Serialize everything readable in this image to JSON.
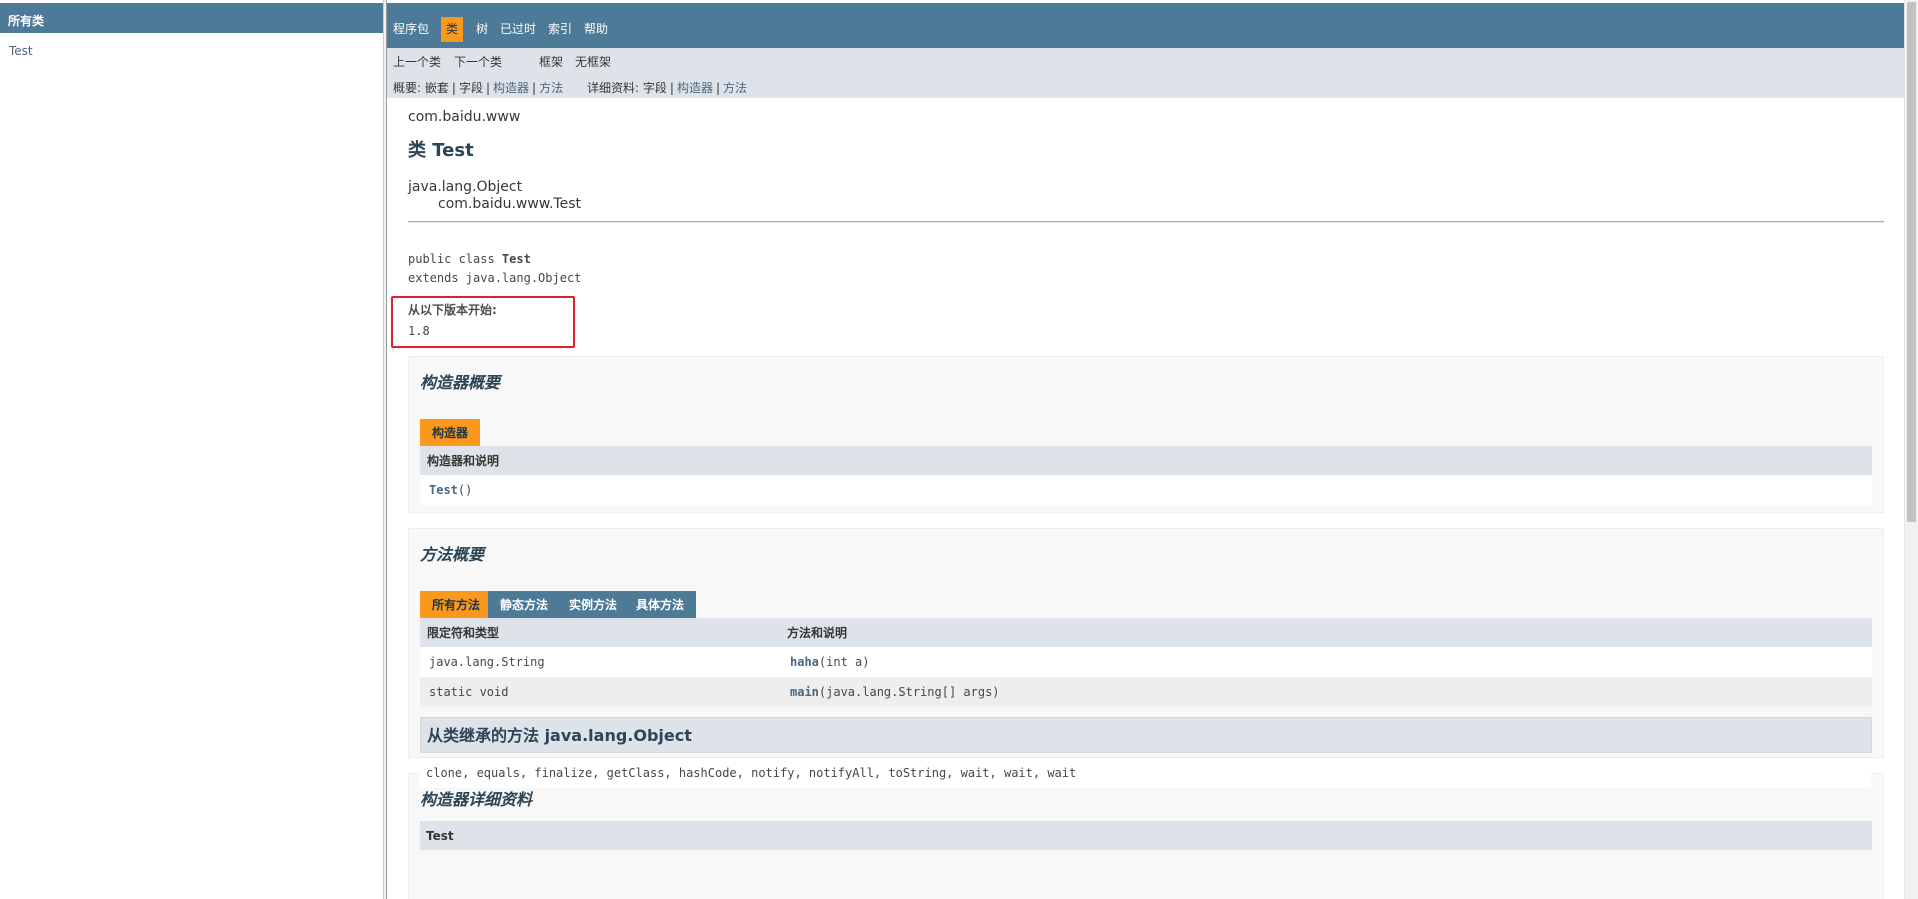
{
  "left_frame": {
    "header": "所有类",
    "classes": [
      "Test"
    ]
  },
  "top_nav": {
    "items": [
      {
        "label": "程序包",
        "active": false
      },
      {
        "label": "类",
        "active": true
      },
      {
        "label": "树",
        "active": false
      },
      {
        "label": "已过时",
        "active": false
      },
      {
        "label": "索引",
        "active": false
      },
      {
        "label": "帮助",
        "active": false
      }
    ]
  },
  "sub_nav": {
    "prev_class": "上一个类",
    "next_class": "下一个类",
    "frames": "框架",
    "no_frames": "无框架",
    "summary_label": "概要:",
    "summary_nested": "嵌套",
    "summary_field": "字段",
    "summary_constr": "构造器",
    "summary_method": "方法",
    "detail_label": "详细资料:",
    "detail_field": "字段",
    "detail_constr": "构造器",
    "detail_method": "方法",
    "pipe": "|"
  },
  "header": {
    "package": "com.baidu.www",
    "title": "类 Test",
    "inheritance": [
      "java.lang.Object",
      "com.baidu.www.Test"
    ]
  },
  "signature": {
    "line1_prefix": "public class ",
    "line1_name": "Test",
    "line2": "extends java.lang.Object"
  },
  "since": {
    "label": "从以下版本开始:",
    "value": "1.8"
  },
  "constructor_summary": {
    "title": "构造器概要",
    "caption": "构造器",
    "column": "构造器和说明",
    "rows": [
      {
        "name": "Test",
        "params": "()"
      }
    ]
  },
  "method_summary": {
    "title": "方法概要",
    "tabs": [
      {
        "label": "所有方法",
        "active": true
      },
      {
        "label": "静态方法",
        "active": false
      },
      {
        "label": "实例方法",
        "active": false
      },
      {
        "label": "具体方法",
        "active": false
      }
    ],
    "columns": [
      "限定符和类型",
      "方法和说明"
    ],
    "rows": [
      {
        "type": "java.lang.String",
        "name": "haha",
        "params": "(int  a)"
      },
      {
        "type": "static void",
        "name": "main",
        "params": "(java.lang.String[]  args)"
      }
    ],
    "inherited_title": "从类继承的方法 java.lang.Object",
    "inherited_methods": "clone, equals, finalize, getClass, hashCode, notify, notifyAll, toString, wait, wait, wait"
  },
  "constructor_detail": {
    "title": "构造器详细资料",
    "first_item": "Test"
  },
  "colors": {
    "nav_bg": "#4D7A97",
    "active_orange": "#F8981D",
    "subnav_bg": "#dee3e9",
    "link": "#4A6782",
    "since_highlight": "#e0202a"
  }
}
